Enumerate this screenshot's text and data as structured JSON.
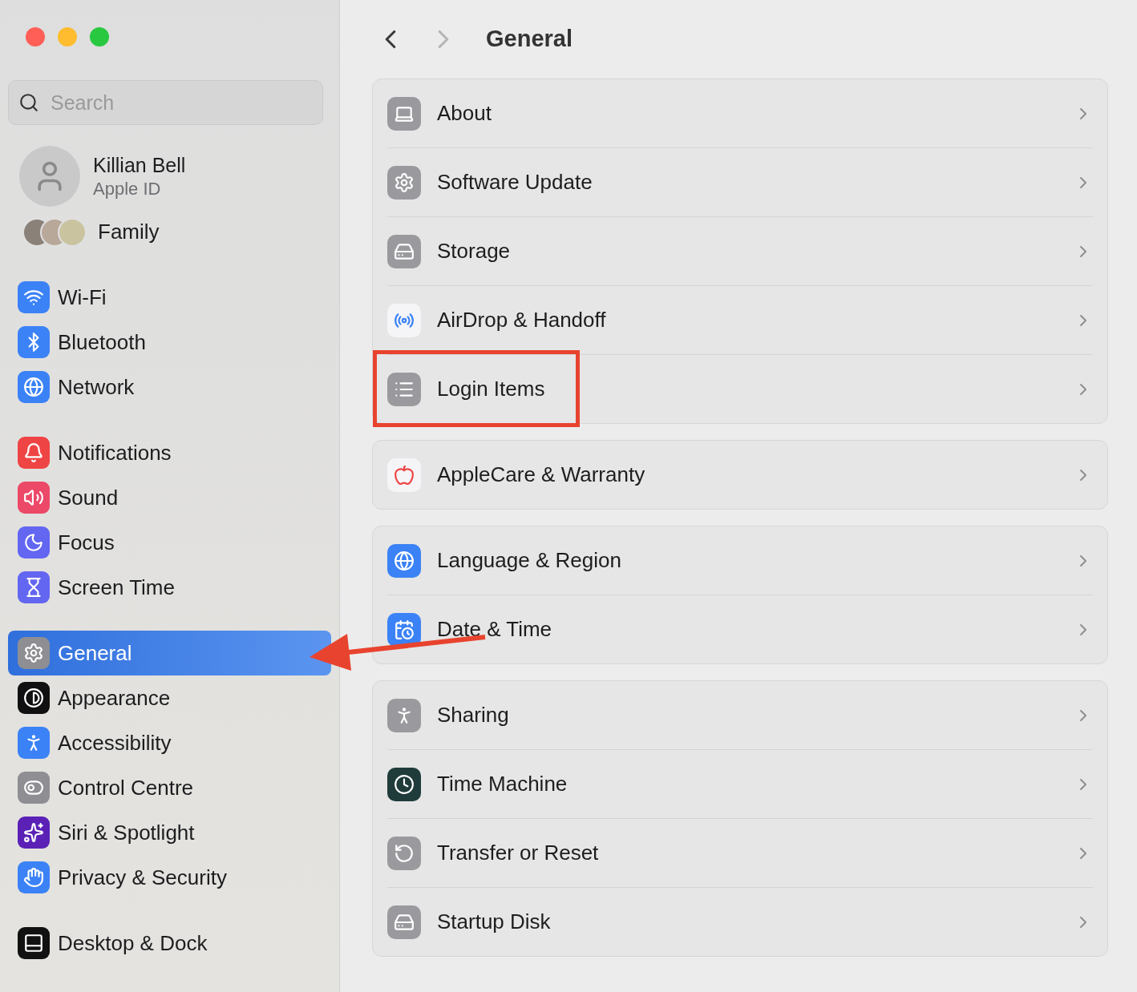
{
  "sidebar": {
    "search": {
      "placeholder": "Search"
    },
    "account": {
      "name": "Killian Bell",
      "subtitle": "Apple ID"
    },
    "family": {
      "label": "Family"
    },
    "groups": [
      [
        {
          "label": "Wi-Fi",
          "selected": false,
          "pointed": false
        },
        {
          "label": "Bluetooth",
          "selected": false,
          "pointed": false
        },
        {
          "label": "Network",
          "selected": false,
          "pointed": false
        }
      ],
      [
        {
          "label": "Notifications",
          "selected": false,
          "pointed": false
        },
        {
          "label": "Sound",
          "selected": false,
          "pointed": false
        },
        {
          "label": "Focus",
          "selected": false,
          "pointed": false
        },
        {
          "label": "Screen Time",
          "selected": false,
          "pointed": false
        }
      ],
      [
        {
          "label": "General",
          "selected": true,
          "pointed": true
        },
        {
          "label": "Appearance",
          "selected": false,
          "pointed": false
        },
        {
          "label": "Accessibility",
          "selected": false,
          "pointed": false
        },
        {
          "label": "Control Centre",
          "selected": false,
          "pointed": false
        },
        {
          "label": "Siri & Spotlight",
          "selected": false,
          "pointed": false
        },
        {
          "label": "Privacy & Security",
          "selected": false,
          "pointed": false
        }
      ],
      [
        {
          "label": "Desktop & Dock",
          "selected": false,
          "pointed": false
        }
      ]
    ]
  },
  "toolbar": {
    "title": "General",
    "back_disabled": false,
    "forward_disabled": true
  },
  "groups": [
    [
      {
        "label": "About",
        "highlighted": false
      },
      {
        "label": "Software Update",
        "highlighted": false
      },
      {
        "label": "Storage",
        "highlighted": false
      },
      {
        "label": "AirDrop & Handoff",
        "highlighted": false
      },
      {
        "label": "Login Items",
        "highlighted": true
      }
    ],
    [
      {
        "label": "AppleCare & Warranty",
        "highlighted": false
      }
    ],
    [
      {
        "label": "Language & Region",
        "highlighted": false
      },
      {
        "label": "Date & Time",
        "highlighted": false
      }
    ],
    [
      {
        "label": "Sharing",
        "highlighted": false
      },
      {
        "label": "Time Machine",
        "highlighted": false
      },
      {
        "label": "Transfer or Reset",
        "highlighted": false
      },
      {
        "label": "Startup Disk",
        "highlighted": false
      }
    ]
  ]
}
